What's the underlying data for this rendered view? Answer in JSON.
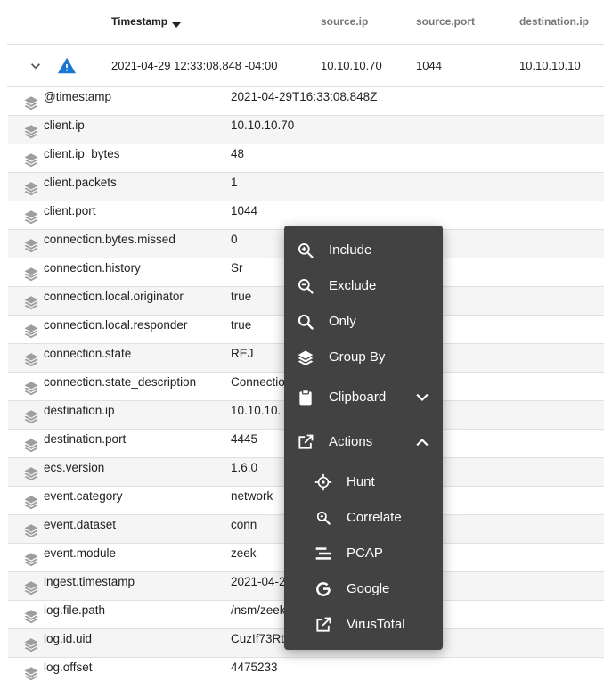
{
  "table": {
    "columns": [
      {
        "label": "Timestamp",
        "sorted": "desc"
      },
      {
        "label": "source.ip"
      },
      {
        "label": "source.port"
      },
      {
        "label": "destination.ip"
      }
    ],
    "event": {
      "timestamp": "2021-04-29 12:33:08.848 -04:00",
      "source_ip": "10.10.10.70",
      "source_port": "1044",
      "destination_ip": "10.10.10.10",
      "severity_icon": "warning-icon"
    }
  },
  "fields": [
    {
      "name": "@timestamp",
      "value": "2021-04-29T16:33:08.848Z"
    },
    {
      "name": "client.ip",
      "value": "10.10.10.70"
    },
    {
      "name": "client.ip_bytes",
      "value": "48"
    },
    {
      "name": "client.packets",
      "value": "1"
    },
    {
      "name": "client.port",
      "value": "1044"
    },
    {
      "name": "connection.bytes.missed",
      "value": "0"
    },
    {
      "name": "connection.history",
      "value": "Sr"
    },
    {
      "name": "connection.local.originator",
      "value": "true"
    },
    {
      "name": "connection.local.responder",
      "value": "true"
    },
    {
      "name": "connection.state",
      "value": "REJ"
    },
    {
      "name": "connection.state_description",
      "value": "Connectio"
    },
    {
      "name": "destination.ip",
      "value": "10.10.10."
    },
    {
      "name": "destination.port",
      "value": "4445"
    },
    {
      "name": "ecs.version",
      "value": "1.6.0"
    },
    {
      "name": "event.category",
      "value": "network"
    },
    {
      "name": "event.dataset",
      "value": "conn"
    },
    {
      "name": "event.module",
      "value": "zeek"
    },
    {
      "name": "ingest.timestamp",
      "value": "2021-04-2"
    },
    {
      "name": "log.file.path",
      "value": "/nsm/zeek"
    },
    {
      "name": "log.id.uid",
      "value": "CuzIf73Rt"
    },
    {
      "name": "log.offset",
      "value": "4475233"
    }
  ],
  "context_menu": {
    "include": "Include",
    "exclude": "Exclude",
    "only": "Only",
    "group_by": "Group By",
    "clipboard": "Clipboard",
    "actions": "Actions",
    "hunt": "Hunt",
    "correlate": "Correlate",
    "pcap": "PCAP",
    "google": "Google",
    "virustotal": "VirusTotal"
  },
  "colors": {
    "menu_background": "#424242",
    "warning": "#1976d2",
    "row_stripe": "#f5f5f5",
    "divider": "#e0e0e0"
  }
}
